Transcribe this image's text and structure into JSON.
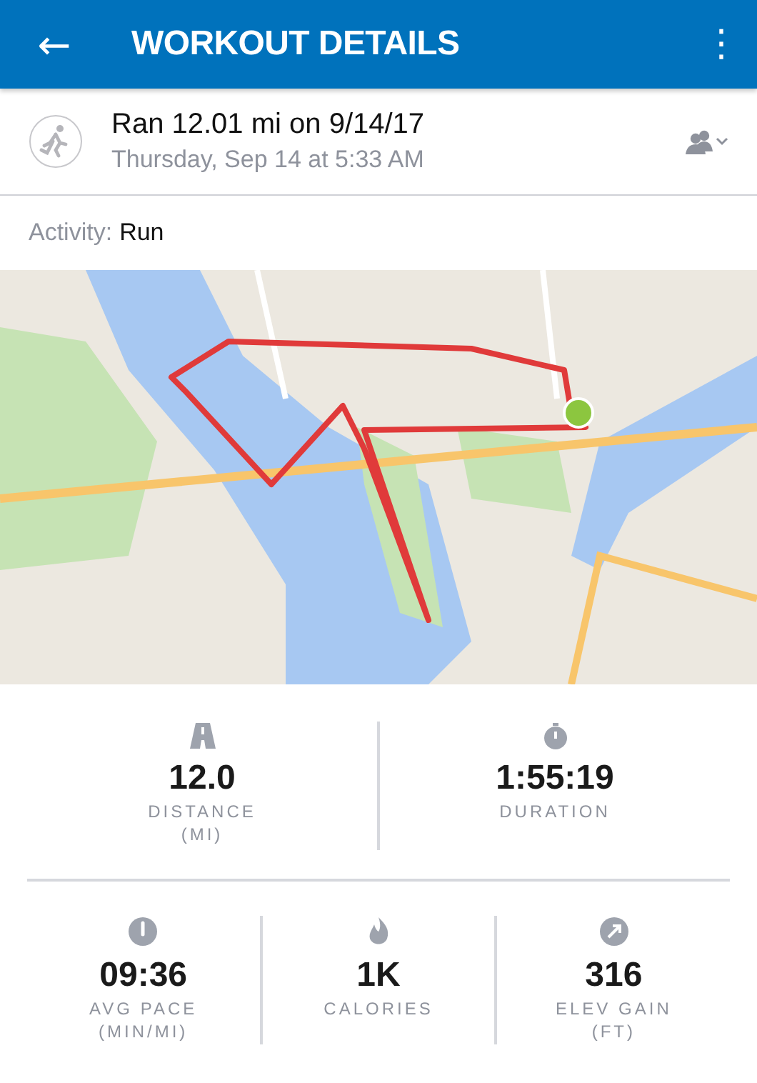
{
  "app_bar": {
    "back": "←",
    "title": "WORKOUT DETAILS",
    "menu": "⋮"
  },
  "workout": {
    "title": "Ran 12.01 mi on 9/14/17",
    "subtitle": "Thursday, Sep 14 at 5:33 AM"
  },
  "activity": {
    "label": "Activity:",
    "value": "Run"
  },
  "stats_top": [
    {
      "kind": "distance",
      "value": "12.0",
      "label": "DISTANCE",
      "unit": "(MI)"
    },
    {
      "kind": "duration",
      "value": "1:55:19",
      "label": "DURATION"
    }
  ],
  "stats_bottom": [
    {
      "kind": "pace",
      "value": "09:36",
      "label": "AVG PACE",
      "unit": "(MIN/MI)"
    },
    {
      "kind": "calories",
      "value": "1K",
      "label": "CALORIES"
    },
    {
      "kind": "elevation",
      "value": "316",
      "label": "ELEV GAIN",
      "unit": "(FT)"
    }
  ]
}
